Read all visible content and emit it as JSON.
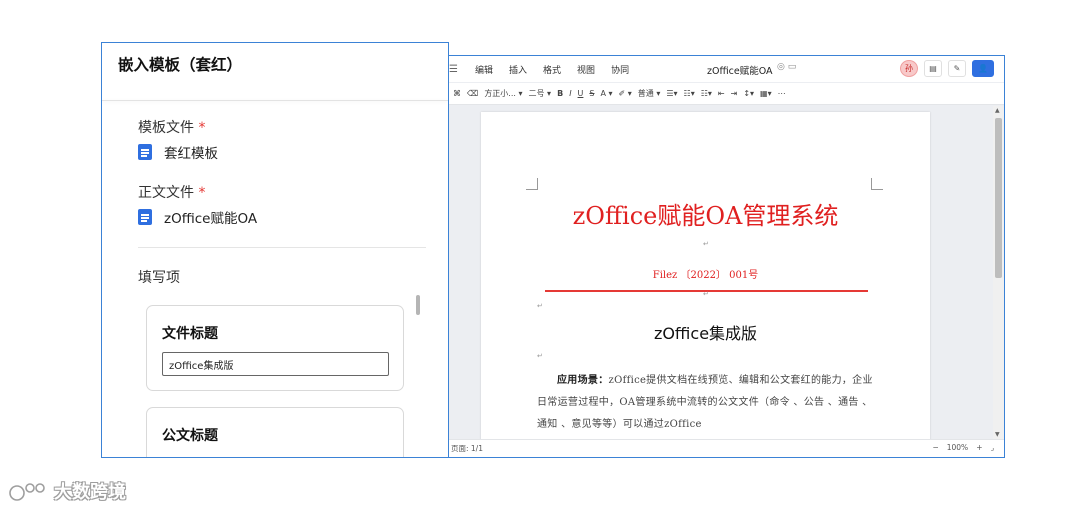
{
  "panel": {
    "title": "嵌入模板（套红）",
    "template_file": {
      "label": "模板文件",
      "required_mark": "*",
      "file_name": "套红模板",
      "icon": "document-icon"
    },
    "body_file": {
      "label": "正文文件",
      "required_mark": "*",
      "file_name": "zOffice赋能OA",
      "icon": "document-icon"
    },
    "fill_section_label": "填写项",
    "cards": [
      {
        "title": "文件标题",
        "input_value": "zOffice集成版"
      },
      {
        "title": "公文标题"
      }
    ]
  },
  "editor": {
    "menu": [
      "编辑",
      "插入",
      "格式",
      "视图",
      "协同"
    ],
    "doc_title": "zOffice赋能OA",
    "user_avatar": "孙",
    "toolbar": {
      "font_family": "方正小...",
      "font_size": "二号",
      "bold": "B",
      "italic": "I",
      "underline": "U",
      "strike": "S",
      "font_color": "A",
      "paragraph_style": "普通"
    },
    "document": {
      "heading": "zOffice赋能OA管理系统",
      "number_line": "Filez 〔2022〕 001号",
      "subheading": "zOffice集成版",
      "body_label": "应用场景：",
      "body_text": "zOffice提供文档在线预览、编辑和公文套红的能力，企业日常运营过程中，OA管理系统中流转的公文文件（命令 、公告 、通告 、通知 、意见等等）可以通过zOffice"
    },
    "status": {
      "pages": "页面: 1/1",
      "zoom": "100%",
      "zoom_out": "−",
      "zoom_in": "+"
    }
  },
  "watermark": {
    "text": "大数跨境"
  },
  "colors": {
    "accent": "#2f6fe0",
    "red_header": "#e02020",
    "border_blue": "#3b82d6"
  }
}
